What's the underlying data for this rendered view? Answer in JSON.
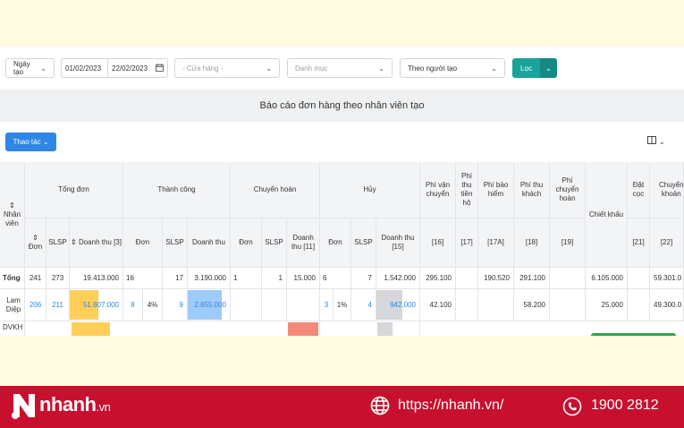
{
  "filters": {
    "date_type": "Ngày tạo",
    "date_from": "01/02/2023",
    "date_to": "22/02/2023",
    "store_placeholder": "- Cửa hàng -",
    "category_placeholder": "Danh mục",
    "group_by": "Theo người tạo",
    "filter_button": "Lọc"
  },
  "report": {
    "title": "Báo cáo đơn hàng theo nhân viên tạo",
    "action_button": "Thao tác"
  },
  "table": {
    "header_top": {
      "employee": "Nhân viên",
      "total_orders": "Tổng đơn",
      "success": "Thành công",
      "returned": "Chuyển hoàn",
      "cancelled": "Hủy",
      "shipping_fee": "Phí vận chuyển",
      "cod_fee": "Phí thu tiền hộ",
      "insurance_fee": "Phí bảo hiểm",
      "customer_fee": "Phí thu khách",
      "return_fee": "Phí chuyển hoàn",
      "discount": "Chiết khấu",
      "deposit": "Đặt cọc",
      "transfer": "Chuyển khoản"
    },
    "header_sub": {
      "orders": "Đơn",
      "slsp": "SLSP",
      "revenue_3": "Doanh thu [3]",
      "s_orders": "Đơn",
      "s_slsp": "SLSP",
      "s_revenue": "Doanh thu",
      "r_orders": "Đơn",
      "r_slsp": "SLSP",
      "r_revenue": "Doanh thu [11]",
      "c_orders": "Đơn",
      "c_slsp": "SLSP",
      "c_revenue": "Doanh thu [15]",
      "n16": "[16]",
      "n17": "[17]",
      "n17a": "[17A]",
      "n18": "[18]",
      "n19": "[19]",
      "n21": "[21]",
      "n22": "[22]"
    },
    "total": {
      "label": "Tổng",
      "orders": "241",
      "slsp": "273",
      "revenue": "19.413.000",
      "s_orders": "16",
      "s_slsp": "17",
      "s_revenue": "3.190.000",
      "r_orders": "1",
      "r_slsp": "1",
      "r_revenue": "15.000",
      "c_orders": "6",
      "c_slsp": "7",
      "c_revenue": "1.542.000",
      "shipping": "295.100",
      "insurance": "190.520",
      "customer_fee": "291.100",
      "discount": "6.105.000",
      "transfer": "59.301.0"
    },
    "row1": {
      "label": "Lam Diệp",
      "orders": "206",
      "slsp": "211",
      "revenue": "51.607.000",
      "revenue_share": 0.55,
      "s_orders": "8",
      "s_pct": "4%",
      "s_slsp": "9",
      "s_revenue": "2.655.000",
      "s_revenue_share": 0.8,
      "c_orders": "3",
      "c_pct": "1%",
      "c_slsp": "4",
      "c_revenue": "942.000",
      "c_revenue_share": 0.6,
      "shipping": "42.100",
      "customer_fee": "58.200",
      "discount": "25.000",
      "transfer": "49.300.0"
    },
    "row2": {
      "label": "DVKH"
    }
  },
  "colors": {
    "accent": "#19a39a",
    "primary_blue": "#2f86e8",
    "bar_yellow": "#ffcf5a",
    "bar_blue": "#9ecbfa",
    "bar_red": "#f4897a",
    "bar_gray": "#d5d7da",
    "brand_red": "#c8102e",
    "canvas": "#fefbe0"
  },
  "footer": {
    "brand": "nhanh",
    "brand_suffix": ".vn",
    "website": "https://nhanh.vn/",
    "hotline": "1900 2812"
  }
}
